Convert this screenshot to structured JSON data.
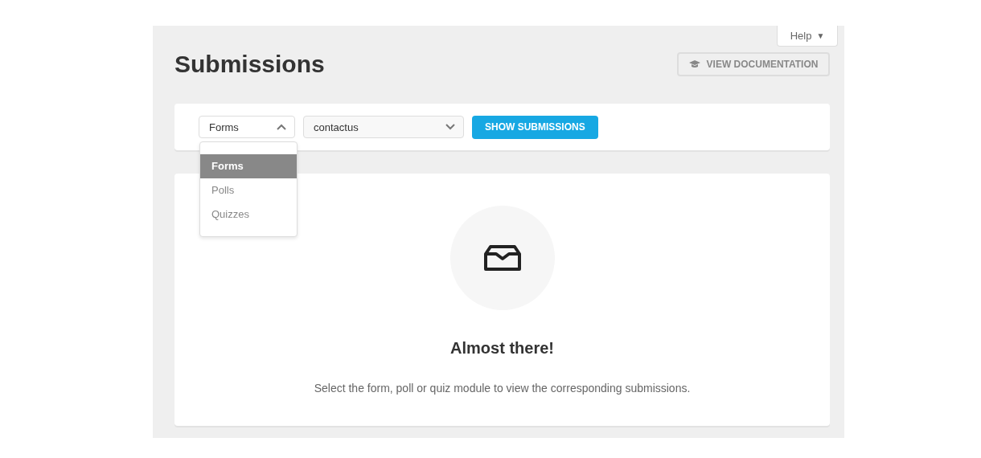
{
  "help_button": {
    "label": "Help",
    "caret": "▼"
  },
  "title": "Submissions",
  "doc_button": {
    "label": "VIEW DOCUMENTATION"
  },
  "filters": {
    "type_select": {
      "value": "Forms",
      "expanded": true,
      "options": [
        {
          "label": "Forms",
          "selected": true
        },
        {
          "label": "Polls",
          "selected": false
        },
        {
          "label": "Quizzes",
          "selected": false
        }
      ]
    },
    "module_select": {
      "value": "contactus",
      "expanded": false
    },
    "submit_button": {
      "label": "SHOW SUBMISSIONS"
    }
  },
  "empty_state": {
    "heading": "Almost there!",
    "message": "Select the form, poll or quiz module to view the corresponding submissions."
  }
}
